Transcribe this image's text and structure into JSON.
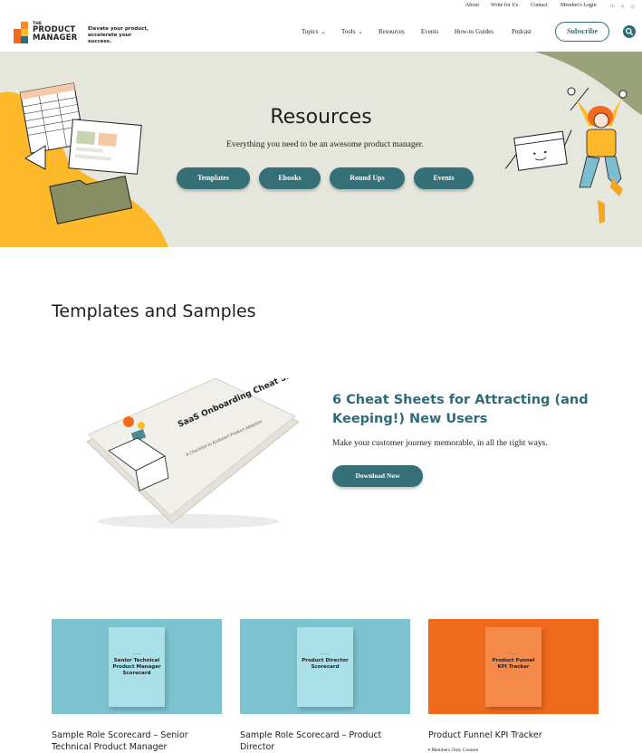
{
  "utility_links": [
    "About",
    "Write for Us",
    "Contact",
    "Member's Login"
  ],
  "social_icons": [
    "linkedin-icon",
    "x-icon",
    "instagram-icon"
  ],
  "logo": {
    "small": "THE",
    "line1": "PRODUCT",
    "line2": "MANAGER"
  },
  "tagline": "Elevate your product, accelerate your success.",
  "nav": {
    "topics": "Topics",
    "tools": "Tools",
    "resources": "Resources",
    "events": "Events",
    "how_to": "How-to Guides",
    "podcast": "Podcast"
  },
  "subscribe_label": "Subscribe",
  "hero": {
    "title": "Resources",
    "subtitle": "Everything you need to be an awesome product manager.",
    "buttons": [
      "Templates",
      "Ebooks",
      "Round Ups",
      "Events"
    ]
  },
  "section_title": "Templates and Samples",
  "feature": {
    "book_title": "SaaS Onboarding Cheat Sheet",
    "book_subtitle": "A Checklist to Kickstart Product Adoption",
    "title": "6 Cheat Sheets for Attracting (and Keeping!) New Users",
    "description": "Make your customer journey memorable, in all the right ways.",
    "cta": "Download Now"
  },
  "cards": [
    {
      "book_label": "Senior Technical Product Manager Scorecard",
      "title": "Sample Role Scorecard – Senior Technical Product Manager",
      "bg": "#7cc3cf",
      "book": "#a9e0ea"
    },
    {
      "book_label": "Product Director Scorecard",
      "title": "Sample Role Scorecard – Product Director",
      "bg": "#7cc3cf",
      "book": "#a9e0ea"
    },
    {
      "book_label": "Product Funnel KPI Tracker",
      "title": "Product Funnel KPI Tracker",
      "bg": "#ef6a1c",
      "book": "#f58a4a"
    }
  ],
  "members_note": "Members Only Content",
  "colors": {
    "teal": "#2e6b77",
    "hero_bg": "#e5e7dd",
    "yellow": "#fdb92a",
    "olive": "#9aa27a"
  }
}
